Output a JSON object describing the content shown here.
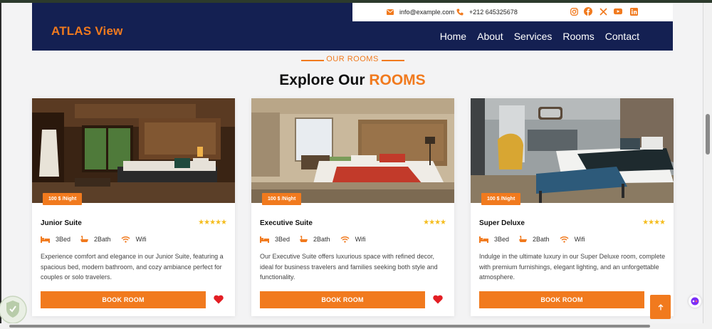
{
  "brand": "ATLAS View",
  "topbar": {
    "email": "info@example.com",
    "phone": "+212 645325678"
  },
  "social": [
    "instagram-icon",
    "facebook-icon",
    "x-icon",
    "youtube-icon",
    "linkedin-icon"
  ],
  "nav": [
    "Home",
    "About",
    "Services",
    "Rooms",
    "Contact"
  ],
  "section": {
    "eyebrow": "OUR ROOMS",
    "title_main": "Explore Our",
    "title_accent": "ROOMS"
  },
  "colors": {
    "accent": "#f17a1e",
    "navbar": "#142052",
    "star": "#f5bd1f",
    "heart": "#e31e24"
  },
  "rooms": [
    {
      "name": "Junior Suite",
      "price": "100 $ /Night",
      "rating": 5,
      "stars": "★★★★★",
      "bed": "3Bed",
      "bath": "2Bath",
      "wifi": "Wifi",
      "description": "Experience comfort and elegance in our Junior Suite, featuring a spacious bed, modern bathroom, and cozy ambiance perfect for couples or solo travelers.",
      "button": "BOOK ROOM"
    },
    {
      "name": "Executive Suite",
      "price": "100 $ /Night",
      "rating": 4,
      "stars": "★★★★",
      "bed": "3Bed",
      "bath": "2Bath",
      "wifi": "Wifi",
      "description": "Our Executive Suite offers luxurious space with refined decor, ideal for business travelers and families seeking both style and functionality.",
      "button": "BOOK ROOM"
    },
    {
      "name": "Super Deluxe",
      "price": "100 $ /Night",
      "rating": 4,
      "stars": "★★★★",
      "bed": "3Bed",
      "bath": "2Bath",
      "wifi": "Wifi",
      "description": "Indulge in the ultimate luxury in our Super Deluxe room, complete with premium furnishings, elegant lighting, and an unforgettable atmosphere.",
      "button": "BOOK ROOM"
    }
  ]
}
